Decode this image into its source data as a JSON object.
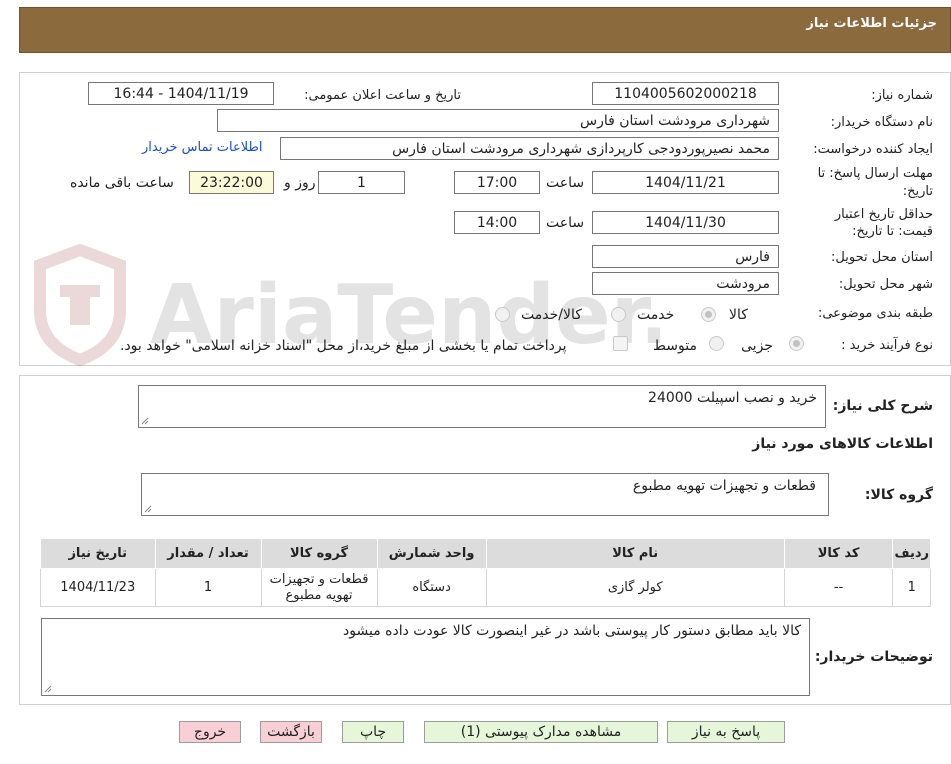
{
  "header": {
    "title": "جزئیات اطلاعات نیاز"
  },
  "watermark": {
    "text": "AriaTender.neT"
  },
  "fields": {
    "need_number_label": "شماره نیاز:",
    "need_number": "1104005602000218",
    "announce_label": "تاریخ و ساعت اعلان عمومی:",
    "announce_value": "1404/11/19 - 16:44",
    "buyer_org_label": "نام دستگاه خریدار:",
    "buyer_org": "شهرداری مرودشت استان فارس",
    "creator_label": "ایجاد کننده درخواست:",
    "creator": "محمد نصیرپوردودجی کارپردازی شهرداری مرودشت استان فارس",
    "contact_link": "اطلاعات تماس خریدار",
    "deadline_label_1": "مهلت ارسال پاسخ: تا",
    "deadline_label_2": "تاریخ:",
    "deadline_date": "1404/11/21",
    "time_label": "ساعت",
    "deadline_time": "17:00",
    "days_value": "1",
    "days_label": "روز و",
    "remaining_time": "23:22:00",
    "remaining_label": "ساعت باقی مانده",
    "validity_label_1": "حداقل تاریخ اعتبار",
    "validity_label_2": "قیمت: تا تاریخ:",
    "validity_date": "1404/11/30",
    "validity_time_label": "ساعت",
    "validity_time": "14:00",
    "province_label": "استان محل تحویل:",
    "province": "فارس",
    "city_label": "شهر محل تحویل:",
    "city": "مرودشت",
    "category_label": "طبقه بندی موضوعی:",
    "category_options": [
      "کالا",
      "خدمت",
      "کالا/خدمت"
    ],
    "process_label": "نوع فرآیند خرید :",
    "process_options": [
      "جزیی",
      "متوسط"
    ],
    "payment_note": "پرداخت تمام یا بخشی از مبلغ خرید،از محل \"اسناد خزانه اسلامی\" خواهد بود."
  },
  "summary": {
    "label": "شرح کلی نیاز:",
    "value": "خرید و نصب اسپیلت 24000"
  },
  "goods": {
    "section_title": "اطلاعات کالاهای مورد نیاز",
    "group_label": "گروه کالا:",
    "group_value": "قطعات و تجهیزات تهویه مطبوع",
    "columns": [
      "ردیف",
      "کد کالا",
      "نام کالا",
      "واحد شمارش",
      "گروه کالا",
      "تعداد / مقدار",
      "تاریخ نیاز"
    ],
    "rows": [
      {
        "row": "1",
        "code": "--",
        "name": "کولر گازی",
        "unit": "دستگاه",
        "group": "قطعات و تجهیزات تهویه مطبوع",
        "qty": "1",
        "date": "1404/11/23"
      }
    ]
  },
  "buyer_notes": {
    "label": "توضیحات خریدار:",
    "value": "کالا باید مطابق دستور کار پیوستی باشد در غیر اینصورت کالا عودت داده میشود"
  },
  "buttons": {
    "reply": "پاسخ به نیاز",
    "attachments": "مشاهده مدارک پیوستی (1)",
    "print": "چاپ",
    "back": "بازگشت",
    "exit": "خروج"
  },
  "colors": {
    "header_bg": "#8b6a3e",
    "link": "#1a4fc4",
    "green_btn": "#e6f7d9",
    "pink_btn": "#f7cfd4",
    "yellow_box": "#fbfbd9"
  }
}
